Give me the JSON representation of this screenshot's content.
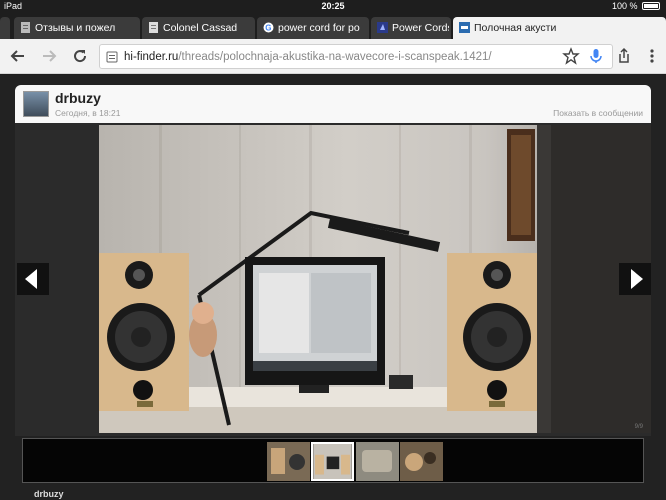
{
  "status_bar": {
    "device": "iPad",
    "time": "20:25",
    "battery": "100 %"
  },
  "tabs": [
    {
      "title": "Отзывы и пожел",
      "favicon_color": "#c0c0c0",
      "active": false
    },
    {
      "title": "Colonel Cassad",
      "favicon_color": "#d9d9d9",
      "active": false
    },
    {
      "title": "power cord for po",
      "favicon_color": "#4285f4",
      "active": false
    },
    {
      "title": "Power Cords h",
      "favicon_color": "#2a3a8a",
      "active": false
    },
    {
      "title": "Полочная акусти",
      "favicon_color": "#2b6cb0",
      "active": true
    }
  ],
  "toolbar": {
    "back_icon": "arrow-left-icon",
    "forward_icon": "arrow-right-icon",
    "reload_icon": "reload-icon",
    "url_host": "hi-finder.ru",
    "url_path": "/threads/polochnaja-akustika-na-wavecore-i-scanspeak.1421/",
    "star_icon": "star-icon",
    "mic_icon": "mic-icon",
    "share_icon": "share-icon",
    "menu_icon": "more-vert-icon"
  },
  "post": {
    "username": "drbuzy",
    "date": "Сегодня, в 18:21",
    "show_in_message": "Показать в сообщении"
  },
  "viewer": {
    "prev_icon": "caret-left-icon",
    "next_icon": "caret-right-icon",
    "counter": "9/9",
    "selected_thumb": 2,
    "thumbs": [
      "thumb-1",
      "thumb-2",
      "thumb-3",
      "thumb-4"
    ]
  },
  "footer": {
    "username": "drbuzy"
  },
  "colors": {
    "active_tab": "#f2f2f2",
    "inactive_tab": "#3b3b3b",
    "page_bg": "#222222"
  }
}
